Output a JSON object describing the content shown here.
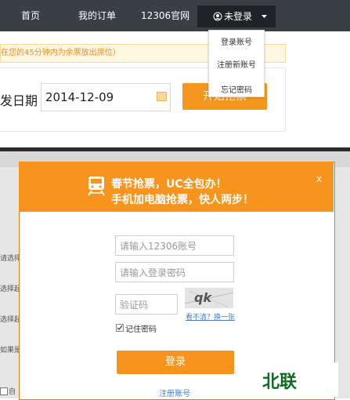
{
  "nav": {
    "home": "首页",
    "my_orders": "我的订单",
    "official_site": "12306官网",
    "account": "未登录"
  },
  "dropdown": {
    "items": [
      "登录账号",
      "注册新账号",
      "忘记密码"
    ]
  },
  "notice": {
    "text": "在您的45分钟内为余票放出席位）"
  },
  "search": {
    "date_label": "发日期",
    "date_value": "2014-12-09",
    "button_label": "开始抢票"
  },
  "background_labels": [
    "请选择",
    "选择起",
    "选择起",
    "如果是",
    "自"
  ],
  "dialog": {
    "headline_1": "春节抢票，UC全包办！",
    "headline_2": "手机加电脑抢票，快人两步！",
    "close_label": "x",
    "account_placeholder": "请输入12306账号",
    "password_placeholder": "请输入登录密码",
    "captcha_placeholder": "验证码",
    "captcha_text": "qk",
    "refresh_link": "看不清？换一张",
    "remember_label": "记住密码",
    "login_button": "登录",
    "register_link": "注册账号"
  },
  "watermark": "北联",
  "colors": {
    "nav_bg": "#3a3f46",
    "accent_orange": "#f7941e",
    "link_blue": "#4a7fc1"
  }
}
